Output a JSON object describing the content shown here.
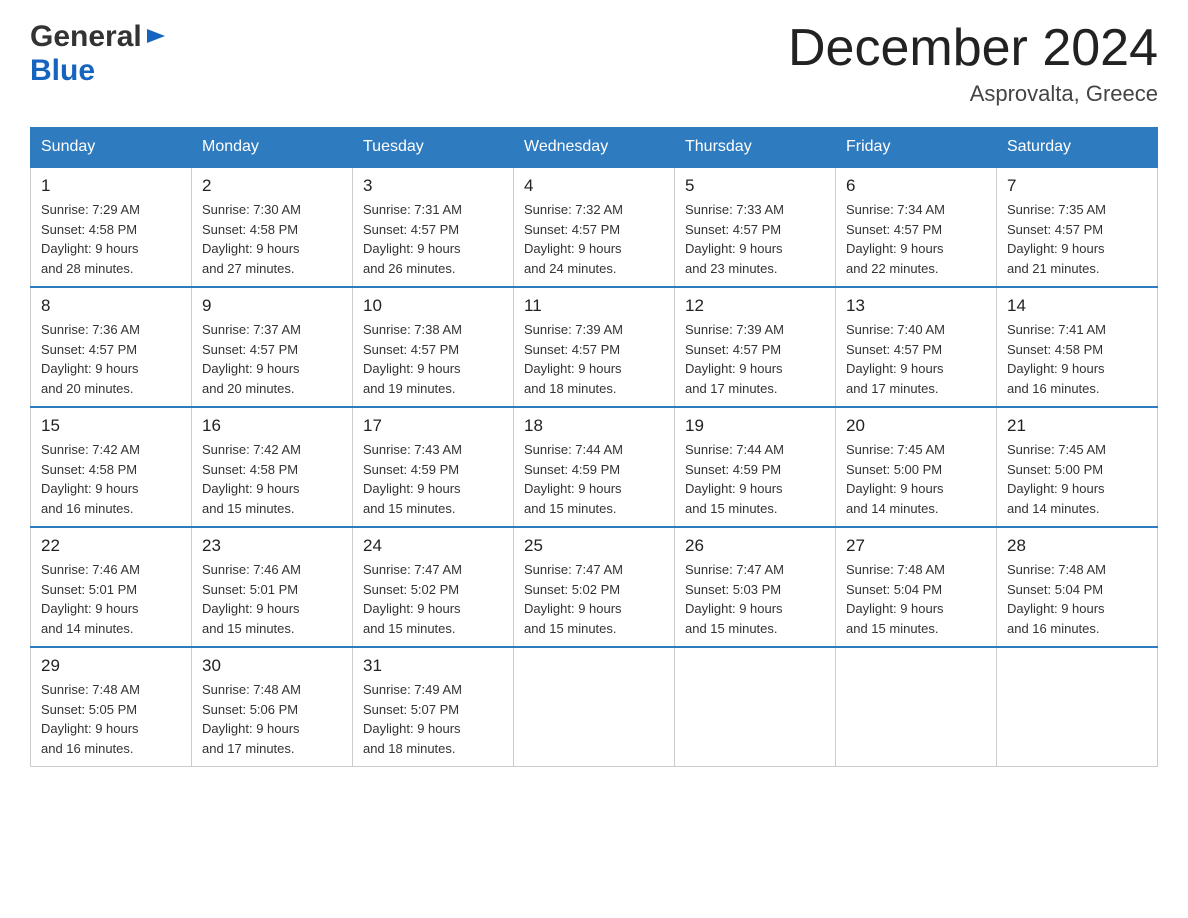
{
  "header": {
    "month_title": "December 2024",
    "location": "Asprovalta, Greece"
  },
  "logo": {
    "general": "General",
    "blue": "Blue"
  },
  "days_of_week": [
    "Sunday",
    "Monday",
    "Tuesday",
    "Wednesday",
    "Thursday",
    "Friday",
    "Saturday"
  ],
  "weeks": [
    [
      {
        "day": "1",
        "sunrise": "7:29 AM",
        "sunset": "4:58 PM",
        "daylight": "9 hours and 28 minutes."
      },
      {
        "day": "2",
        "sunrise": "7:30 AM",
        "sunset": "4:58 PM",
        "daylight": "9 hours and 27 minutes."
      },
      {
        "day": "3",
        "sunrise": "7:31 AM",
        "sunset": "4:57 PM",
        "daylight": "9 hours and 26 minutes."
      },
      {
        "day": "4",
        "sunrise": "7:32 AM",
        "sunset": "4:57 PM",
        "daylight": "9 hours and 24 minutes."
      },
      {
        "day": "5",
        "sunrise": "7:33 AM",
        "sunset": "4:57 PM",
        "daylight": "9 hours and 23 minutes."
      },
      {
        "day": "6",
        "sunrise": "7:34 AM",
        "sunset": "4:57 PM",
        "daylight": "9 hours and 22 minutes."
      },
      {
        "day": "7",
        "sunrise": "7:35 AM",
        "sunset": "4:57 PM",
        "daylight": "9 hours and 21 minutes."
      }
    ],
    [
      {
        "day": "8",
        "sunrise": "7:36 AM",
        "sunset": "4:57 PM",
        "daylight": "9 hours and 20 minutes."
      },
      {
        "day": "9",
        "sunrise": "7:37 AM",
        "sunset": "4:57 PM",
        "daylight": "9 hours and 20 minutes."
      },
      {
        "day": "10",
        "sunrise": "7:38 AM",
        "sunset": "4:57 PM",
        "daylight": "9 hours and 19 minutes."
      },
      {
        "day": "11",
        "sunrise": "7:39 AM",
        "sunset": "4:57 PM",
        "daylight": "9 hours and 18 minutes."
      },
      {
        "day": "12",
        "sunrise": "7:39 AM",
        "sunset": "4:57 PM",
        "daylight": "9 hours and 17 minutes."
      },
      {
        "day": "13",
        "sunrise": "7:40 AM",
        "sunset": "4:57 PM",
        "daylight": "9 hours and 17 minutes."
      },
      {
        "day": "14",
        "sunrise": "7:41 AM",
        "sunset": "4:58 PM",
        "daylight": "9 hours and 16 minutes."
      }
    ],
    [
      {
        "day": "15",
        "sunrise": "7:42 AM",
        "sunset": "4:58 PM",
        "daylight": "9 hours and 16 minutes."
      },
      {
        "day": "16",
        "sunrise": "7:42 AM",
        "sunset": "4:58 PM",
        "daylight": "9 hours and 15 minutes."
      },
      {
        "day": "17",
        "sunrise": "7:43 AM",
        "sunset": "4:59 PM",
        "daylight": "9 hours and 15 minutes."
      },
      {
        "day": "18",
        "sunrise": "7:44 AM",
        "sunset": "4:59 PM",
        "daylight": "9 hours and 15 minutes."
      },
      {
        "day": "19",
        "sunrise": "7:44 AM",
        "sunset": "4:59 PM",
        "daylight": "9 hours and 15 minutes."
      },
      {
        "day": "20",
        "sunrise": "7:45 AM",
        "sunset": "5:00 PM",
        "daylight": "9 hours and 14 minutes."
      },
      {
        "day": "21",
        "sunrise": "7:45 AM",
        "sunset": "5:00 PM",
        "daylight": "9 hours and 14 minutes."
      }
    ],
    [
      {
        "day": "22",
        "sunrise": "7:46 AM",
        "sunset": "5:01 PM",
        "daylight": "9 hours and 14 minutes."
      },
      {
        "day": "23",
        "sunrise": "7:46 AM",
        "sunset": "5:01 PM",
        "daylight": "9 hours and 15 minutes."
      },
      {
        "day": "24",
        "sunrise": "7:47 AM",
        "sunset": "5:02 PM",
        "daylight": "9 hours and 15 minutes."
      },
      {
        "day": "25",
        "sunrise": "7:47 AM",
        "sunset": "5:02 PM",
        "daylight": "9 hours and 15 minutes."
      },
      {
        "day": "26",
        "sunrise": "7:47 AM",
        "sunset": "5:03 PM",
        "daylight": "9 hours and 15 minutes."
      },
      {
        "day": "27",
        "sunrise": "7:48 AM",
        "sunset": "5:04 PM",
        "daylight": "9 hours and 15 minutes."
      },
      {
        "day": "28",
        "sunrise": "7:48 AM",
        "sunset": "5:04 PM",
        "daylight": "9 hours and 16 minutes."
      }
    ],
    [
      {
        "day": "29",
        "sunrise": "7:48 AM",
        "sunset": "5:05 PM",
        "daylight": "9 hours and 16 minutes."
      },
      {
        "day": "30",
        "sunrise": "7:48 AM",
        "sunset": "5:06 PM",
        "daylight": "9 hours and 17 minutes."
      },
      {
        "day": "31",
        "sunrise": "7:49 AM",
        "sunset": "5:07 PM",
        "daylight": "9 hours and 18 minutes."
      },
      null,
      null,
      null,
      null
    ]
  ],
  "labels": {
    "sunrise": "Sunrise:",
    "sunset": "Sunset:",
    "daylight": "Daylight:"
  }
}
